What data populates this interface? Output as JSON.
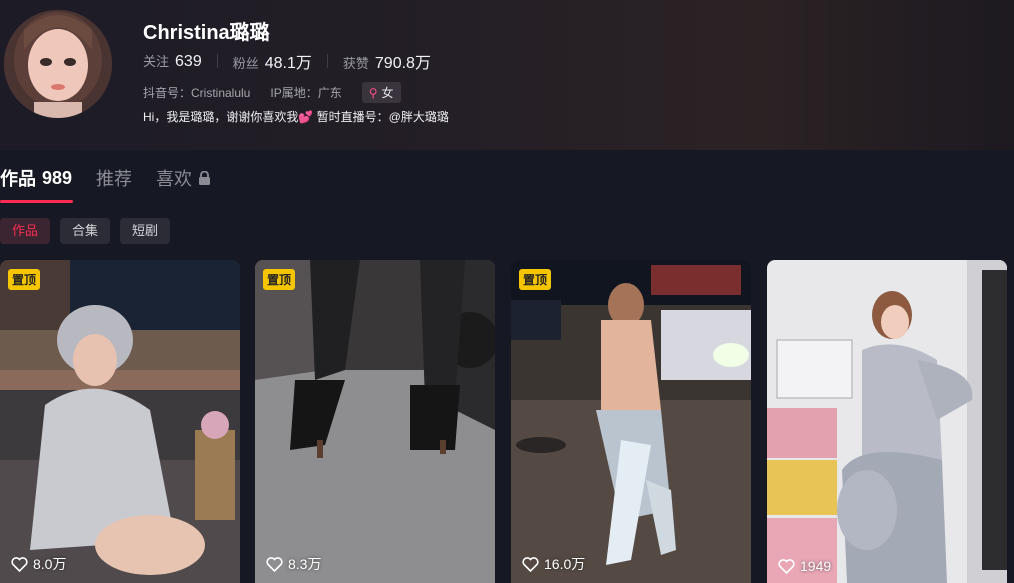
{
  "profile": {
    "name": "Christina璐璐",
    "stats": [
      {
        "label": "关注",
        "value": "639"
      },
      {
        "label": "粉丝",
        "value": "48.1万"
      },
      {
        "label": "获赞",
        "value": "790.8万"
      }
    ],
    "douyin_id": "抖音号：Cristinalulu",
    "ip_location": "IP属地：广东",
    "gender": "女",
    "gender_icon": "female-icon",
    "bio_before": "Hi，我是璐璐，谢谢你喜欢我",
    "bio_after": " 暂时直播号：@胖大璐璐",
    "bio_emoji_icon": "hearts-icon"
  },
  "tabs": [
    {
      "label": "作品",
      "count": "989"
    },
    {
      "label": "推荐"
    },
    {
      "label": "喜欢",
      "icon": "lock-icon"
    }
  ],
  "chips": [
    "作品",
    "合集",
    "短剧"
  ],
  "videos": [
    {
      "pinned": "置顶",
      "likes": "8.0万"
    },
    {
      "pinned": "置顶",
      "likes": "8.3万"
    },
    {
      "pinned": "置顶",
      "likes": "16.0万"
    },
    {
      "likes": "1949"
    }
  ],
  "colors": {
    "accent": "#fe2c55",
    "pin": "#f5c600",
    "background": "#161823"
  }
}
